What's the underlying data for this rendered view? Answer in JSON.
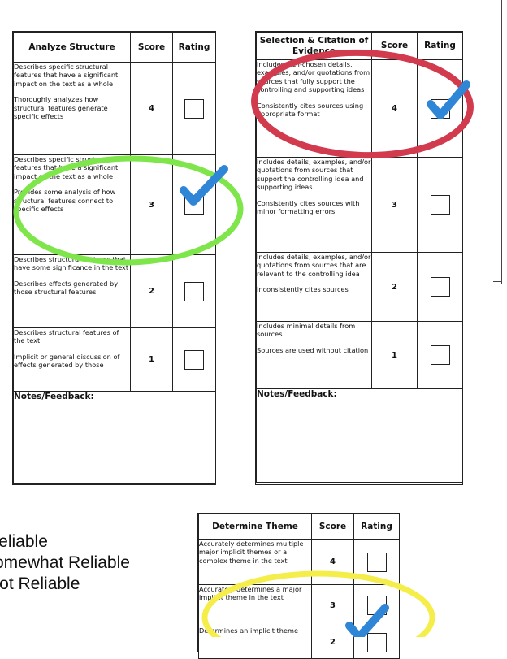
{
  "rubrics": [
    {
      "headers": {
        "criterion": "Analyze Structure",
        "score": "Score",
        "rating": "Rating"
      },
      "rows": [
        {
          "criteria": [
            "Describes specific structural features that have a significant impact on the text as a whole",
            "Thoroughly analyzes how structural features generate specific effects"
          ],
          "score": "4",
          "checked": false
        },
        {
          "criteria": [
            "Describes specific structural features that have a significant impact on the text as a whole",
            "Provides some analysis of how structural features connect to specific effects"
          ],
          "score": "3",
          "checked": true
        },
        {
          "criteria": [
            "Describes structural features that have some significance in the text",
            "Describes effects generated by those structural features"
          ],
          "score": "2",
          "checked": false
        },
        {
          "criteria": [
            "Describes structural features of the text",
            "Implicit or general discussion of effects generated by those"
          ],
          "score": "1",
          "checked": false
        }
      ],
      "notes_label": "Notes/Feedback:",
      "annotation": {
        "shape": "ellipse",
        "color": "#7ee64a",
        "encircles_score": "3"
      }
    },
    {
      "headers": {
        "criterion": "Selection & Citation of Evidence",
        "score": "Score",
        "rating": "Rating"
      },
      "rows": [
        {
          "criteria": [
            "Includes well-chosen details, examples, and/or quotations from sources that fully support the controlling and supporting ideas",
            "Consistently cites sources using appropriate format"
          ],
          "score": "4",
          "checked": true
        },
        {
          "criteria": [
            "Includes details, examples, and/or quotations from sources that support the controlling idea and supporting ideas",
            "Consistently cites sources with minor formatting errors"
          ],
          "score": "3",
          "checked": false
        },
        {
          "criteria": [
            "Includes details, examples, and/or quotations from sources that are relevant to the controlling idea",
            "Inconsistently cites sources"
          ],
          "score": "2",
          "checked": false
        },
        {
          "criteria": [
            "Includes minimal details from sources",
            "Sources are used without citation"
          ],
          "score": "1",
          "checked": false
        }
      ],
      "notes_label": "Notes/Feedback:",
      "annotation": {
        "shape": "ellipse",
        "color": "#d23a4e",
        "encircles_score": "4"
      }
    },
    {
      "headers": {
        "criterion": "Determine Theme",
        "score": "Score",
        "rating": "Rating"
      },
      "rows": [
        {
          "criteria": [
            "Accurately determines multiple major implicit themes or a complex theme in the text"
          ],
          "score": "4",
          "checked": false
        },
        {
          "criteria": [
            "Accurately determines a major implicit theme in the text"
          ],
          "score": "3",
          "checked": false
        },
        {
          "criteria": [
            "Determines an implicit theme"
          ],
          "score": "2",
          "checked": true
        }
      ],
      "annotation": {
        "shape": "ellipse",
        "color": "#f5ee4a",
        "encircles_score": "2"
      }
    }
  ],
  "legend": [
    "Reliable",
    "Somewhat Reliable",
    "Not Reliable"
  ],
  "colors": {
    "check": "#2f86d6",
    "green_circle": "#7ee64a",
    "red_circle": "#d23a4e",
    "yellow_circle": "#f5ee4a"
  }
}
